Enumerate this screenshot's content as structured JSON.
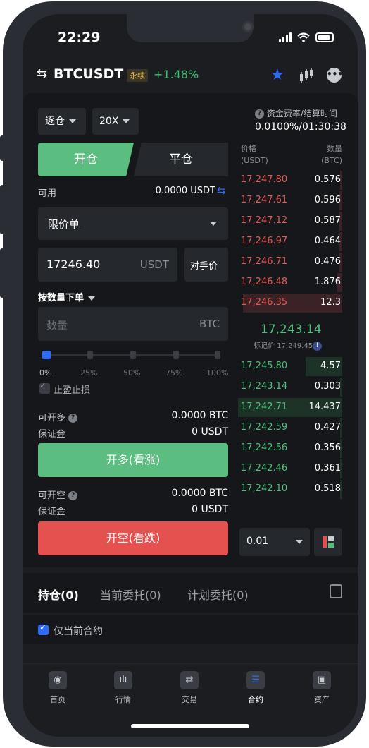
{
  "status": {
    "time": "22:29"
  },
  "header": {
    "symbol": "BTCUSDT",
    "tag": "永续",
    "change": "+1.48%"
  },
  "margin_mode": "逐仓",
  "leverage": "20X",
  "funding": {
    "label": "资金费率/结算时间",
    "value": "0.0100%/01:30:38"
  },
  "tabs": {
    "open": "开仓",
    "close": "平仓"
  },
  "available": {
    "label": "可用",
    "value": "0.0000 USDT"
  },
  "order_type": "限价单",
  "price_input": {
    "value": "17246.40",
    "unit": "USDT",
    "counterparty": "对手价"
  },
  "qty_mode": "按数量下单",
  "qty_input": {
    "placeholder": "数量",
    "unit": "BTC"
  },
  "slider": {
    "value_pct": 0,
    "marks": [
      "0%",
      "25%",
      "50%",
      "75%",
      "100%"
    ]
  },
  "tpsl": {
    "label": "止盈止损"
  },
  "long": {
    "can_open_label": "可开多",
    "can_open": "0.0000 BTC",
    "margin_label": "保证金",
    "margin": "0 USDT",
    "button": "开多(看涨)"
  },
  "short": {
    "can_open_label": "可开空",
    "can_open": "0.0000 BTC",
    "margin_label": "保证金",
    "margin": "0 USDT",
    "button": "开空(看跌)"
  },
  "orderbook": {
    "price_head": "价格",
    "price_unit": "(USDT)",
    "qty_head": "数量",
    "qty_unit": "(BTC)",
    "asks": [
      {
        "price": "17,247.80",
        "qty": "0.576",
        "depth": 0.02
      },
      {
        "price": "17,247.61",
        "qty": "0.596",
        "depth": 0.03
      },
      {
        "price": "17,247.12",
        "qty": "0.587",
        "depth": 0.03
      },
      {
        "price": "17,246.97",
        "qty": "0.464",
        "depth": 0.03
      },
      {
        "price": "17,246.71",
        "qty": "0.476",
        "depth": 0.03
      },
      {
        "price": "17,246.48",
        "qty": "1.876",
        "depth": 0.05
      },
      {
        "price": "17,246.35",
        "qty": "12.3",
        "depth": 0.95
      }
    ],
    "last_price": "17,243.14",
    "mark_label": "标记价",
    "mark_price": "17,249.45",
    "bids": [
      {
        "price": "17,245.80",
        "qty": "4.57",
        "depth": 0.35
      },
      {
        "price": "17,243.14",
        "qty": "0.303",
        "depth": 0.02
      },
      {
        "price": "17,242.71",
        "qty": "14.437",
        "depth": 1.0
      },
      {
        "price": "17,242.59",
        "qty": "0.427",
        "depth": 0.02
      },
      {
        "price": "17,242.56",
        "qty": "0.356",
        "depth": 0.02
      },
      {
        "price": "17,242.46",
        "qty": "0.361",
        "depth": 0.02
      },
      {
        "price": "17,242.10",
        "qty": "0.518",
        "depth": 0.02
      }
    ],
    "precision": "0.01"
  },
  "position_tabs": [
    "持仓(0)",
    "当前委托(0)",
    "计划委托(0)"
  ],
  "only_current": "仅当前合约",
  "nav": [
    "首页",
    "行情",
    "交易",
    "合约",
    "资产"
  ],
  "colors": {
    "green": "#5bbd80",
    "red": "#e5514f",
    "accent": "#2e6bf5"
  }
}
